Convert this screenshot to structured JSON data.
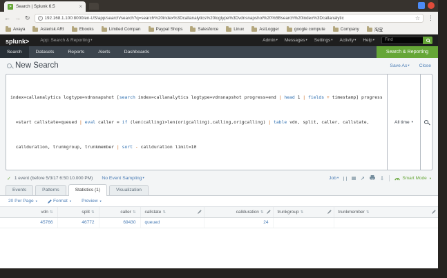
{
  "icons": {
    "chevron": "▾",
    "tab_close": "×",
    "back": "←",
    "forward": "→",
    "refresh": "↻",
    "info": "i",
    "star": "☆",
    "menu_dots": "⋮",
    "check": "✓",
    "sort": "⇅",
    "share": "↗",
    "download": "⇩",
    "logo_gt": ">",
    "favicon_gt": ">"
  },
  "browser": {
    "tab_title": "Search | Splunk 6.5",
    "url": "192.168.1.100:8000/en-US/app/search/search?q=search%20index%3Dcallanalytics%20logtype%3Dvdnsnapshot%20%5Bsearch%20index%3Dcallanalytic",
    "bookmarks": [
      "Avaya",
      "Asterisk ARI",
      "Ebooks",
      "Limited Compan",
      "Paypal Shops",
      "Salesforce",
      "Linux",
      "AstLogger",
      "google compute",
      "Company",
      "淘宝"
    ]
  },
  "splunk_bar": {
    "logo": "splunk",
    "app_label": "App: Search & Reporting",
    "menus": [
      "Admin",
      "Messages",
      "Settings",
      "Activity",
      "Help"
    ],
    "find_label": "Find"
  },
  "app_nav": {
    "items": [
      "Search",
      "Datasets",
      "Reports",
      "Alerts",
      "Dashboards"
    ],
    "app_name": "Search & Reporting"
  },
  "page": {
    "title": "New Search",
    "save_as": "Save As",
    "close_link": "Close"
  },
  "search": {
    "time_range": "All time",
    "q1": [
      "index=callanalytics logtype=vdnsnapshot [",
      "search",
      " index=callanalytics logtype=vdnsnapshot progress=end ",
      "|",
      " ",
      "head",
      " 1 ",
      "|",
      " ",
      "fields",
      " ",
      "+",
      " timestamp] progress"
    ],
    "q2": [
      "  =start callstate=queued ",
      "|",
      " ",
      "eval",
      " caller = ",
      "if",
      " (len(calling)>len(origcalling),calling,origcalling) ",
      "|",
      " ",
      "table",
      " vdn, split, caller, callstate,"
    ],
    "q3": [
      "  callduration, trunkgroup, trunkmember ",
      "|",
      " ",
      "sort",
      " ",
      "-",
      " callduration limit=10"
    ]
  },
  "job_bar": {
    "event_count": "1 event (before 5/3/17 6:50:10.000 PM)",
    "sampling": "No Event Sampling",
    "job_label": "Job",
    "mode_label": "Smart Mode"
  },
  "tabs": [
    "Events",
    "Patterns",
    "Statistics (1)",
    "Visualization"
  ],
  "results_toolbar": {
    "per_page": "20 Per Page",
    "format_label": "Format",
    "preview": "Preview"
  },
  "table": {
    "columns": [
      "vdn",
      "split",
      "caller",
      "callstate",
      "callduration",
      "trunkgroup",
      "trunkmember"
    ],
    "rows": [
      [
        "45766",
        "46772",
        "69430",
        "queued",
        "24",
        "",
        ""
      ]
    ]
  },
  "colors": {
    "splunk_green": "#65a637",
    "link_blue": "#4a7cb5",
    "app_bar": "#3c454e",
    "cmd_blue": "#2e6fb0",
    "op_orange": "#c9671b"
  }
}
